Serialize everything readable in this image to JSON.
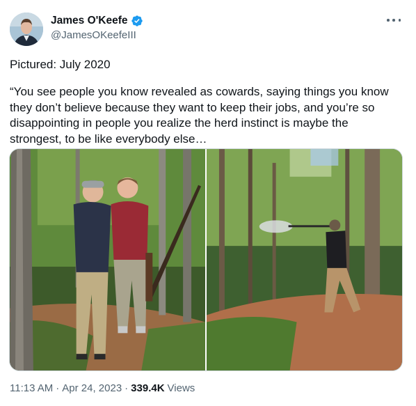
{
  "author": {
    "display_name": "James O'Keefe",
    "handle": "@JamesOKeefeIII",
    "verified_color": "#1d9bf0"
  },
  "tweet": {
    "line1": "Pictured: July 2020",
    "quote": "“You see people you know revealed as cowards, saying things you know they don’t believe because they want to keep their jobs, and you’re so disappointing in people you realize the herd instinct is maybe the strongest, to be like everybody else…"
  },
  "meta": {
    "time": "11:13 AM",
    "sep1": "·",
    "date": "Apr 24, 2023",
    "sep2": "·",
    "views_count": "339.4K",
    "views_label": "Views"
  },
  "icons": {
    "more": "more-options-icon",
    "verified": "verified-badge-icon"
  }
}
